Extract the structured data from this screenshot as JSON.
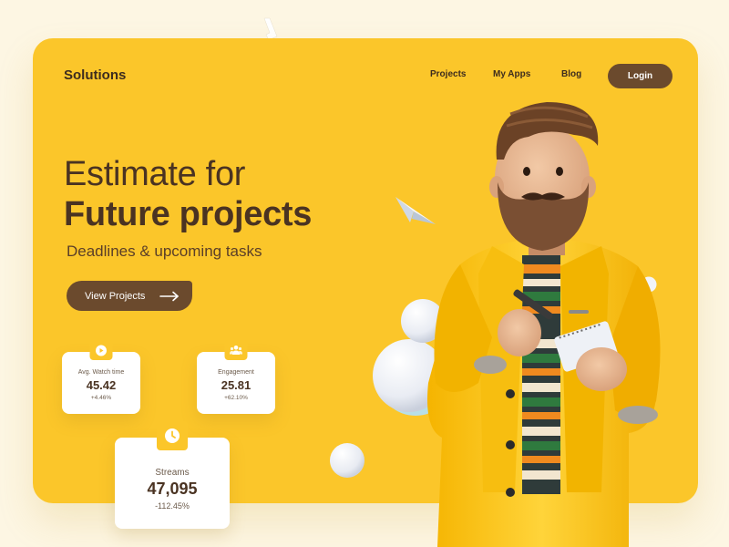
{
  "nav": {
    "logo": "Solutions",
    "links": [
      "Projects",
      "My Apps",
      "Blog"
    ],
    "login_label": "Login"
  },
  "hero": {
    "title_light": "Estimate for",
    "title_bold": "Future projects",
    "subtitle": "Deadlines & upcoming tasks",
    "cta_label": "View Projects"
  },
  "stats": [
    {
      "label": "Avg. Watch time",
      "value": "45.42",
      "delta": "+4.46%",
      "icon": "play-icon"
    },
    {
      "label": "Engagement",
      "value": "25.81",
      "delta": "+62.10%",
      "icon": "users-icon"
    },
    {
      "label": "Streams",
      "value": "47,095",
      "delta": "-112.45%",
      "icon": "clock-icon"
    }
  ],
  "colors": {
    "background": "#fdf6e3",
    "accent_yellow": "#fbc62a",
    "brand_brown": "#6b4a2d",
    "text_dark": "#4a3322"
  }
}
